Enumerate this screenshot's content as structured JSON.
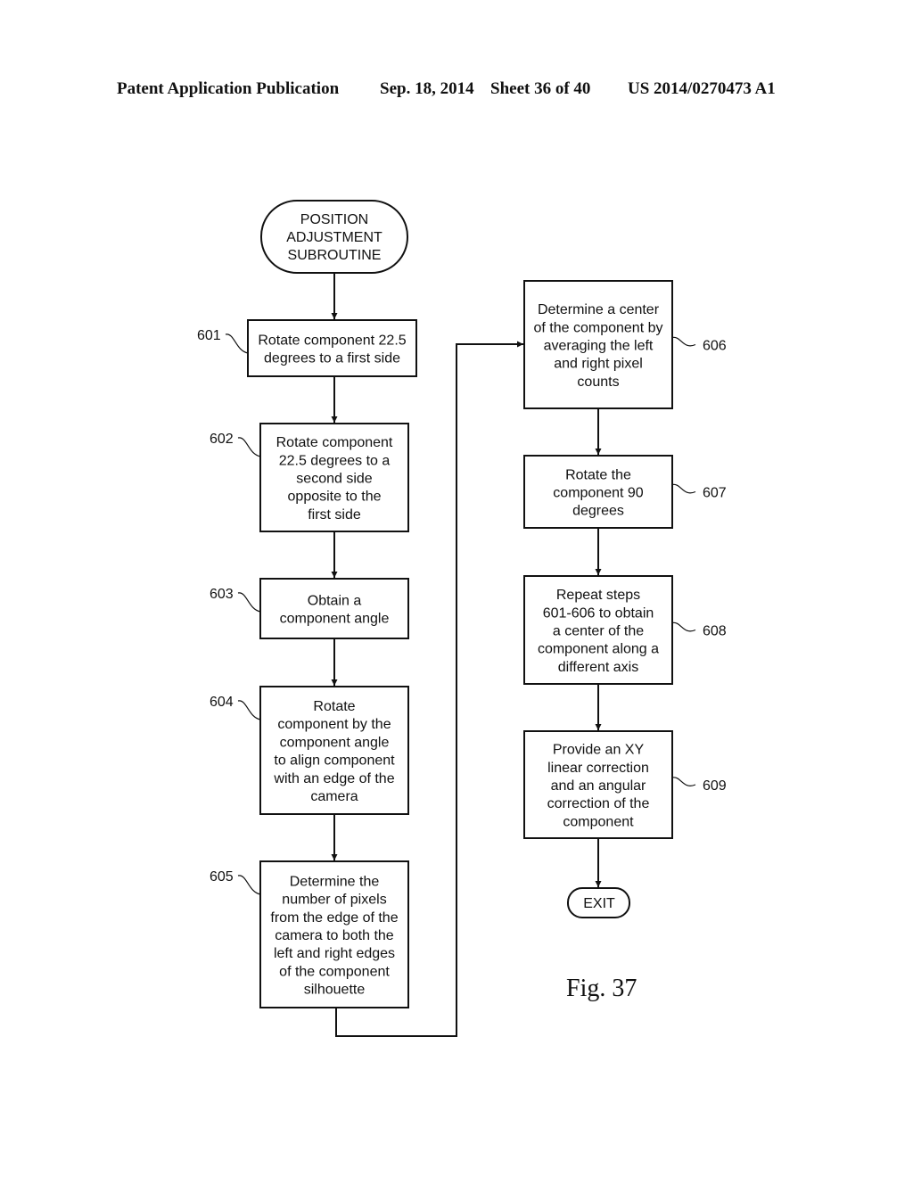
{
  "header": {
    "publication": "Patent Application Publication",
    "date": "Sep. 18, 2014",
    "sheet": "Sheet 36 of 40",
    "number": "US 2014/0270473 A1"
  },
  "figure_label": "Fig. 37",
  "start": {
    "lines": [
      "POSITION",
      "ADJUSTMENT",
      "SUBROUTINE"
    ]
  },
  "end": {
    "lines": [
      "EXIT"
    ]
  },
  "steps": [
    {
      "ref": "601",
      "lines": [
        "Rotate component 22.5",
        "degrees to a first side"
      ]
    },
    {
      "ref": "602",
      "lines": [
        "Rotate component",
        "22.5 degrees to a",
        "second side",
        "opposite to the",
        "first side"
      ]
    },
    {
      "ref": "603",
      "lines": [
        "Obtain a",
        "component angle"
      ]
    },
    {
      "ref": "604",
      "lines": [
        "Rotate",
        "component by the",
        "component angle",
        "to align component",
        "with an edge of the",
        "camera"
      ]
    },
    {
      "ref": "605",
      "lines": [
        "Determine the",
        "number of pixels",
        "from the edge of the",
        "camera to both the",
        "left and right edges",
        "of the component",
        "silhouette"
      ]
    },
    {
      "ref": "606",
      "lines": [
        "Determine a center",
        "of the component by",
        "averaging the left",
        "and right pixel",
        "counts"
      ]
    },
    {
      "ref": "607",
      "lines": [
        "Rotate the",
        "component 90",
        "degrees"
      ]
    },
    {
      "ref": "608",
      "lines": [
        "Repeat steps",
        "601-606 to obtain",
        "a center of the",
        "component along a",
        "different axis"
      ]
    },
    {
      "ref": "609",
      "lines": [
        "Provide an XY",
        "linear correction",
        "and an angular",
        "correction of the",
        "component"
      ]
    }
  ]
}
